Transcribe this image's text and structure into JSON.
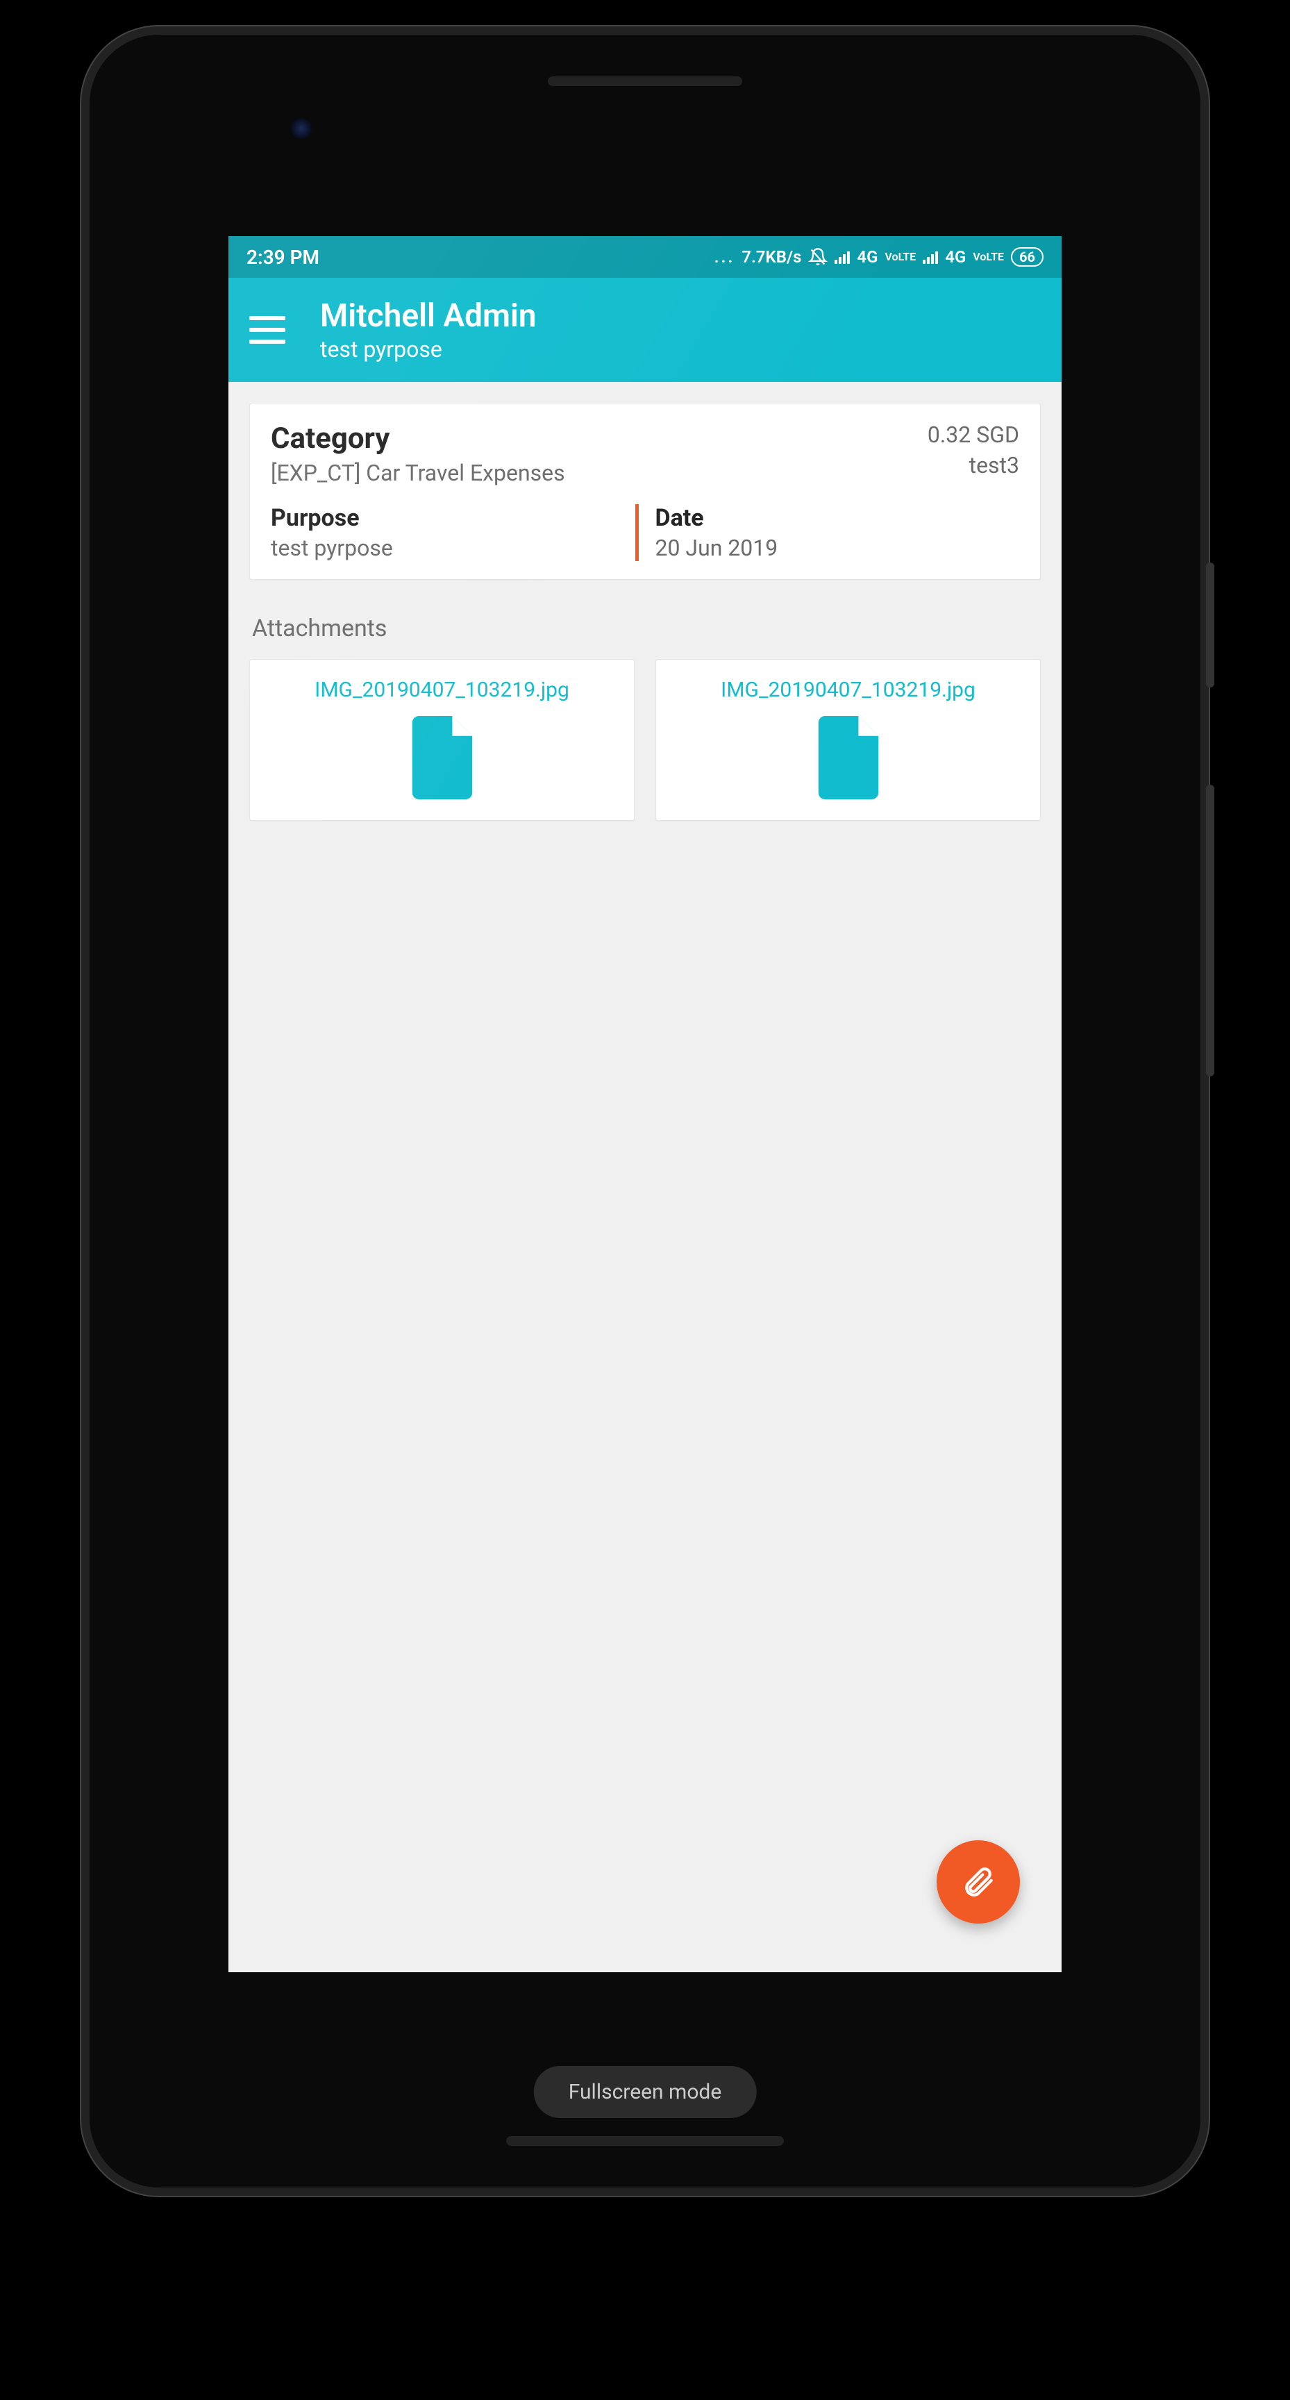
{
  "status_bar": {
    "time": "2:39 PM",
    "data_rate": "7.7KB/s",
    "net_label_1": "4G",
    "lte_1": "VoLTE",
    "net_label_2": "4G",
    "lte_2": "VoLTE",
    "battery": "66"
  },
  "app_bar": {
    "title": "Mitchell Admin",
    "subtitle": "test pyrpose"
  },
  "category": {
    "label": "Category",
    "value": "[EXP_CT] Car Travel Expenses"
  },
  "amount_text": "0.32 SGD",
  "account_text": "test3",
  "purpose": {
    "label": "Purpose",
    "value": "test pyrpose"
  },
  "date": {
    "label": "Date",
    "value": "20 Jun 2019"
  },
  "attachments": {
    "label": "Attachments",
    "items": [
      {
        "name": "IMG_20190407_103219.jpg"
      },
      {
        "name": "IMG_20190407_103219.jpg"
      }
    ]
  },
  "fullscreen_label": "Fullscreen mode"
}
